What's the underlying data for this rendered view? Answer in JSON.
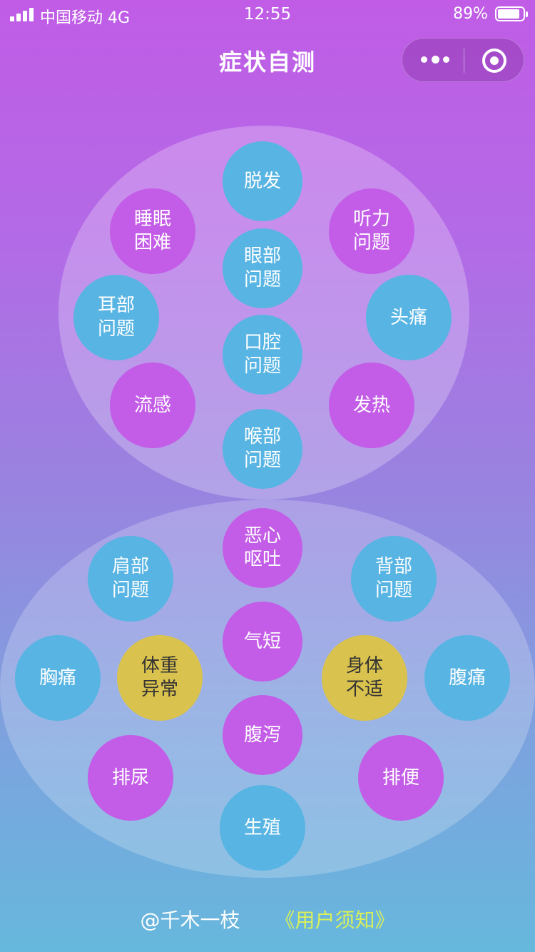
{
  "status": {
    "carrier": "中国移动  4G",
    "time": "12:55",
    "battery": "89%",
    "battery_level": 0.89
  },
  "nav": {
    "title": "症状自测",
    "more_icon": "more-dots-icon",
    "close_icon": "target-circle-icon"
  },
  "symptoms": {
    "hair_loss": "脱发",
    "sleep": "睡眠\n困难",
    "hearing": "听力\n问题",
    "eye": "眼部\n问题",
    "ear": "耳部\n问题",
    "headache": "头痛",
    "mouth": "口腔\n问题",
    "flu": "流感",
    "fever": "发热",
    "throat": "喉部\n问题",
    "nausea": "恶心\n呕吐",
    "shoulder": "肩部\n问题",
    "back": "背部\n问题",
    "shortness": "气短",
    "chest": "胸痛",
    "weight": "体重\n异常",
    "unwell": "身体\n不适",
    "abdominal": "腹痛",
    "diarrhea": "腹泻",
    "urination": "排尿",
    "defecation": "排便",
    "reproductive": "生殖"
  },
  "colors": {
    "blue": "#58b4e3",
    "purple": "#c35ce7",
    "yellow": "#d9c24e",
    "link": "#d8f05a"
  },
  "footer": {
    "author": "@千木一枝",
    "notice": "《用户须知》"
  }
}
